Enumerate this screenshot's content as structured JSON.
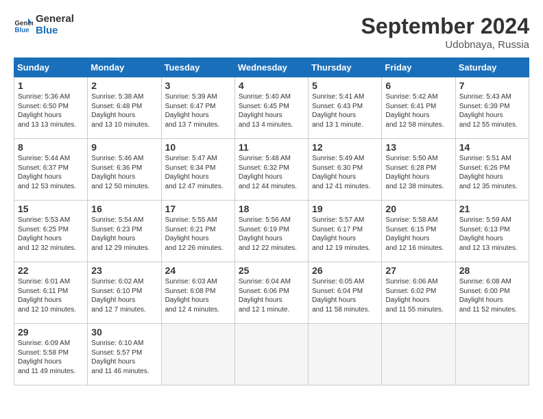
{
  "logo": {
    "line1": "General",
    "line2": "Blue"
  },
  "title": "September 2024",
  "location": "Udobnaya, Russia",
  "weekdays": [
    "Sunday",
    "Monday",
    "Tuesday",
    "Wednesday",
    "Thursday",
    "Friday",
    "Saturday"
  ],
  "weeks": [
    [
      {
        "day": "1",
        "sunrise": "5:36 AM",
        "sunset": "6:50 PM",
        "daylight": "13 hours and 13 minutes."
      },
      {
        "day": "2",
        "sunrise": "5:38 AM",
        "sunset": "6:48 PM",
        "daylight": "13 hours and 10 minutes."
      },
      {
        "day": "3",
        "sunrise": "5:39 AM",
        "sunset": "6:47 PM",
        "daylight": "13 hours and 7 minutes."
      },
      {
        "day": "4",
        "sunrise": "5:40 AM",
        "sunset": "6:45 PM",
        "daylight": "13 hours and 4 minutes."
      },
      {
        "day": "5",
        "sunrise": "5:41 AM",
        "sunset": "6:43 PM",
        "daylight": "13 hours and 1 minute."
      },
      {
        "day": "6",
        "sunrise": "5:42 AM",
        "sunset": "6:41 PM",
        "daylight": "12 hours and 58 minutes."
      },
      {
        "day": "7",
        "sunrise": "5:43 AM",
        "sunset": "6:39 PM",
        "daylight": "12 hours and 55 minutes."
      }
    ],
    [
      {
        "day": "8",
        "sunrise": "5:44 AM",
        "sunset": "6:37 PM",
        "daylight": "12 hours and 53 minutes."
      },
      {
        "day": "9",
        "sunrise": "5:46 AM",
        "sunset": "6:36 PM",
        "daylight": "12 hours and 50 minutes."
      },
      {
        "day": "10",
        "sunrise": "5:47 AM",
        "sunset": "6:34 PM",
        "daylight": "12 hours and 47 minutes."
      },
      {
        "day": "11",
        "sunrise": "5:48 AM",
        "sunset": "6:32 PM",
        "daylight": "12 hours and 44 minutes."
      },
      {
        "day": "12",
        "sunrise": "5:49 AM",
        "sunset": "6:30 PM",
        "daylight": "12 hours and 41 minutes."
      },
      {
        "day": "13",
        "sunrise": "5:50 AM",
        "sunset": "6:28 PM",
        "daylight": "12 hours and 38 minutes."
      },
      {
        "day": "14",
        "sunrise": "5:51 AM",
        "sunset": "6:26 PM",
        "daylight": "12 hours and 35 minutes."
      }
    ],
    [
      {
        "day": "15",
        "sunrise": "5:53 AM",
        "sunset": "6:25 PM",
        "daylight": "12 hours and 32 minutes."
      },
      {
        "day": "16",
        "sunrise": "5:54 AM",
        "sunset": "6:23 PM",
        "daylight": "12 hours and 29 minutes."
      },
      {
        "day": "17",
        "sunrise": "5:55 AM",
        "sunset": "6:21 PM",
        "daylight": "12 hours and 26 minutes."
      },
      {
        "day": "18",
        "sunrise": "5:56 AM",
        "sunset": "6:19 PM",
        "daylight": "12 hours and 22 minutes."
      },
      {
        "day": "19",
        "sunrise": "5:57 AM",
        "sunset": "6:17 PM",
        "daylight": "12 hours and 19 minutes."
      },
      {
        "day": "20",
        "sunrise": "5:58 AM",
        "sunset": "6:15 PM",
        "daylight": "12 hours and 16 minutes."
      },
      {
        "day": "21",
        "sunrise": "5:59 AM",
        "sunset": "6:13 PM",
        "daylight": "12 hours and 13 minutes."
      }
    ],
    [
      {
        "day": "22",
        "sunrise": "6:01 AM",
        "sunset": "6:11 PM",
        "daylight": "12 hours and 10 minutes."
      },
      {
        "day": "23",
        "sunrise": "6:02 AM",
        "sunset": "6:10 PM",
        "daylight": "12 hours and 7 minutes."
      },
      {
        "day": "24",
        "sunrise": "6:03 AM",
        "sunset": "6:08 PM",
        "daylight": "12 hours and 4 minutes."
      },
      {
        "day": "25",
        "sunrise": "6:04 AM",
        "sunset": "6:06 PM",
        "daylight": "12 hours and 1 minute."
      },
      {
        "day": "26",
        "sunrise": "6:05 AM",
        "sunset": "6:04 PM",
        "daylight": "11 hours and 58 minutes."
      },
      {
        "day": "27",
        "sunrise": "6:06 AM",
        "sunset": "6:02 PM",
        "daylight": "11 hours and 55 minutes."
      },
      {
        "day": "28",
        "sunrise": "6:08 AM",
        "sunset": "6:00 PM",
        "daylight": "11 hours and 52 minutes."
      }
    ],
    [
      {
        "day": "29",
        "sunrise": "6:09 AM",
        "sunset": "5:58 PM",
        "daylight": "11 hours and 49 minutes."
      },
      {
        "day": "30",
        "sunrise": "6:10 AM",
        "sunset": "5:57 PM",
        "daylight": "11 hours and 46 minutes."
      },
      null,
      null,
      null,
      null,
      null
    ]
  ]
}
